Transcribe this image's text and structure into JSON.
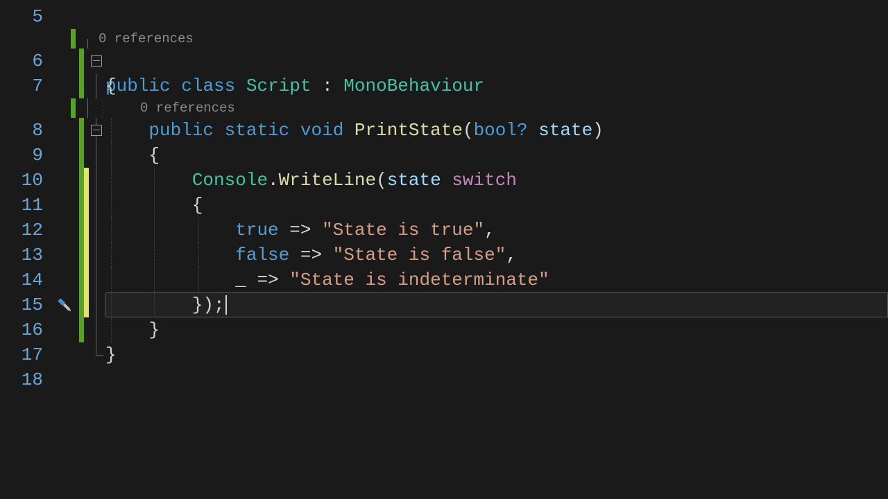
{
  "lines": {
    "l5": "5",
    "l6": "6",
    "l7": "7",
    "l8": "8",
    "l9": "9",
    "l10": "10",
    "l11": "11",
    "l12": "12",
    "l13": "13",
    "l14": "14",
    "l15": "15",
    "l16": "16",
    "l17": "17",
    "l18": "18"
  },
  "codelens": {
    "class": "0 references",
    "method": "0 references"
  },
  "tok": {
    "public": "public",
    "class": "class",
    "static": "static",
    "void": "void",
    "switch": "switch",
    "boolq": "bool?",
    "true": "true",
    "false": "false",
    "underscore": "_",
    "arrow": " => ",
    "Script": "Script",
    "MonoBehaviour": "MonoBehaviour",
    "PrintState": "PrintState",
    "Console": "Console",
    "WriteLine": "WriteLine",
    "state": "state",
    "colon": " : ",
    "space": " ",
    "dot": ".",
    "lparen": "(",
    "rparen": ")",
    "lbrace": "{",
    "rbrace": "}",
    "comma": ",",
    "semi": ";",
    "rbrace_rparen_semi": "});"
  },
  "str": {
    "s_true": "\"State is true\"",
    "s_false": "\"State is false\"",
    "s_ind": "\"State is indeterminate\""
  }
}
